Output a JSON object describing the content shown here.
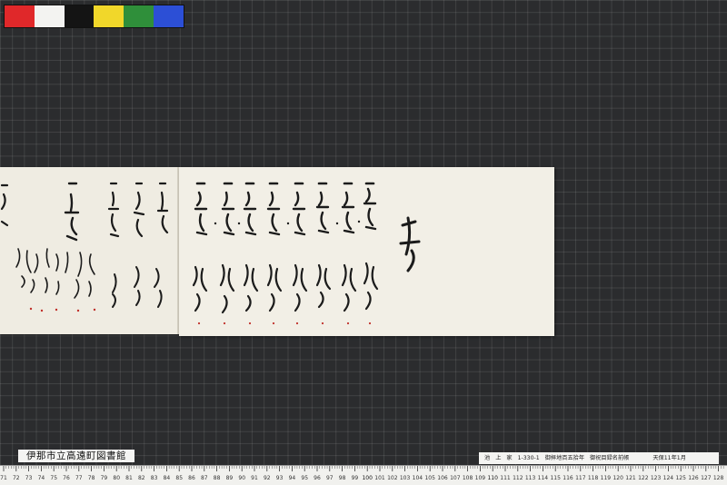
{
  "color_chart": {
    "swatches": [
      "#e0282a",
      "#f3f3f1",
      "#141414",
      "#f1d72a",
      "#2f8f3a",
      "#2c4fd6"
    ]
  },
  "labels": {
    "library": "伊那市立高遠町図書館",
    "catalog": [
      "池",
      "上",
      "家",
      "1-330-1",
      "御拝地百五拾年",
      "御祝目録名前帳",
      "天保11年1月"
    ]
  },
  "ruler": {
    "numbers": [
      "71",
      "72",
      "73",
      "74",
      "75",
      "76",
      "77",
      "78",
      "79",
      "80",
      "81",
      "82",
      "83",
      "84",
      "85",
      "86",
      "87",
      "88",
      "89",
      "90",
      "91",
      "92",
      "93",
      "94",
      "95",
      "96",
      "97",
      "98",
      "99",
      "100",
      "101",
      "102",
      "103",
      "104",
      "105",
      "106",
      "107",
      "108",
      "109",
      "110",
      "111",
      "112",
      "113",
      "114",
      "115",
      "116",
      "117",
      "118",
      "119",
      "120",
      "121",
      "122",
      "123",
      "124",
      "125",
      "126",
      "127",
      "128"
    ]
  },
  "document": {
    "description_icon": "handwritten-japanese-scroll"
  }
}
